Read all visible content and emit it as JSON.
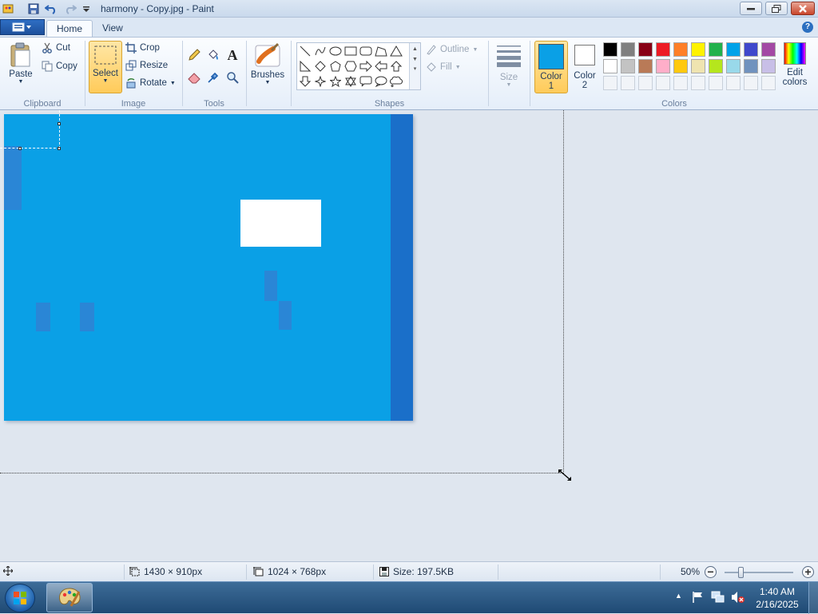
{
  "window": {
    "title": "harmony - Copy.jpg - Paint"
  },
  "tabs": [
    {
      "label": "Home"
    },
    {
      "label": "View"
    }
  ],
  "clipboard": {
    "paste": "Paste",
    "cut": "Cut",
    "copy": "Copy",
    "group": "Clipboard"
  },
  "image": {
    "select": "Select",
    "crop": "Crop",
    "resize": "Resize",
    "rotate": "Rotate",
    "group": "Image"
  },
  "tools": {
    "group": "Tools"
  },
  "brushes": {
    "label": "Brushes"
  },
  "shapes": {
    "outline": "Outline",
    "fill": "Fill",
    "group": "Shapes"
  },
  "size": {
    "label": "Size"
  },
  "colors": {
    "color1_line1": "Color",
    "color1_line2": "1",
    "color2_line1": "Color",
    "color2_line2": "2",
    "edit_line1": "Edit",
    "edit_line2": "colors",
    "group": "Colors",
    "color1_value": "#0aa0e6",
    "color2_value": "#ffffff",
    "palette_row1": [
      "#000000",
      "#7f7f7f",
      "#880015",
      "#ed1c24",
      "#ff7f27",
      "#fff200",
      "#22b14c",
      "#00a2e8",
      "#3f48cc",
      "#a349a4"
    ],
    "palette_row2": [
      "#ffffff",
      "#c3c3c3",
      "#b97a57",
      "#ffaec9",
      "#ffc90e",
      "#efe4b0",
      "#b5e61d",
      "#99d9ea",
      "#7092be",
      "#c8bfe7"
    ]
  },
  "status": {
    "cursor_pos": "",
    "selection_size": "1430 × 910px",
    "image_size": "1024 × 768px",
    "file_size": "Size: 197.5KB",
    "zoom": "50%"
  },
  "taskbar": {
    "time": "1:40 AM",
    "date": "2/16/2025"
  },
  "artwork_colors": {
    "background": "#0aa0e6",
    "strip": "#1a6fc9",
    "blocks": "#2a86d6",
    "white_rect": "#ffffff"
  }
}
